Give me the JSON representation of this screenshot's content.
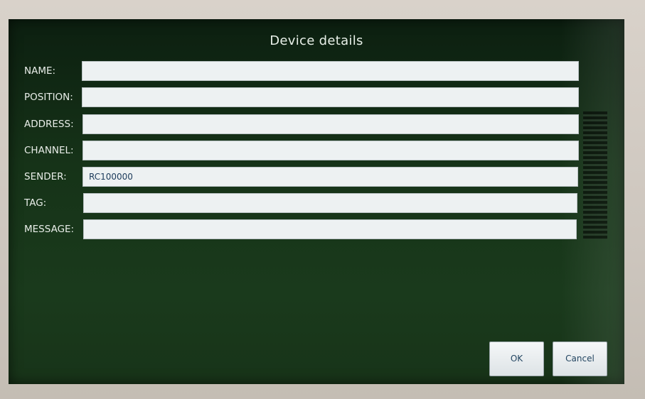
{
  "dialog": {
    "title": "Device details"
  },
  "fields": [
    {
      "label": "NAME:",
      "value": ""
    },
    {
      "label": "POSITION:",
      "value": ""
    },
    {
      "label": "ADDRESS:",
      "value": ""
    },
    {
      "label": "CHANNEL:",
      "value": ""
    },
    {
      "label": "SENDER:",
      "value": "RC100000"
    },
    {
      "label": "TAG:",
      "value": ""
    },
    {
      "label": "MESSAGE:",
      "value": ""
    }
  ],
  "buttons": {
    "ok_label": "OK",
    "cancel_label": "Cancel"
  }
}
